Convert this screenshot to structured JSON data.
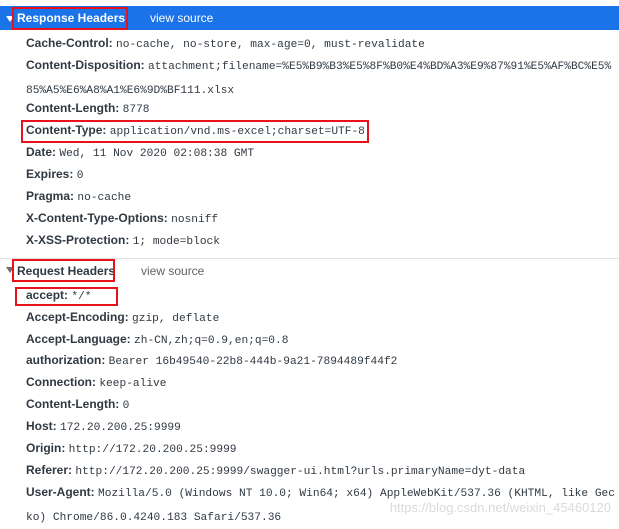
{
  "response_headers": {
    "title": "Response Headers",
    "view_source": "view source",
    "items": [
      {
        "key": "Cache-Control:",
        "value": "no-cache, no-store, max-age=0, must-revalidate"
      },
      {
        "key": "Content-Disposition:",
        "value": "attachment;filename=%E5%B9%B3%E5%8F%B0%E4%BD%A3%E9%87%91%E5%AF%BC%E5%85%A5%E6%A8%A1%E6%9D%BF111.xlsx"
      },
      {
        "key": "Content-Length:",
        "value": "8778"
      },
      {
        "key": "Content-Type:",
        "value": "application/vnd.ms-excel;charset=UTF-8"
      },
      {
        "key": "Date:",
        "value": "Wed, 11 Nov 2020 02:08:38 GMT"
      },
      {
        "key": "Expires:",
        "value": "0"
      },
      {
        "key": "Pragma:",
        "value": "no-cache"
      },
      {
        "key": "X-Content-Type-Options:",
        "value": "nosniff"
      },
      {
        "key": "X-XSS-Protection:",
        "value": "1; mode=block"
      }
    ]
  },
  "request_headers": {
    "title": "Request Headers",
    "view_source": "view source",
    "items": [
      {
        "key": "accept:",
        "value": "*/*"
      },
      {
        "key": "Accept-Encoding:",
        "value": "gzip, deflate"
      },
      {
        "key": "Accept-Language:",
        "value": "zh-CN,zh;q=0.9,en;q=0.8"
      },
      {
        "key": "authorization:",
        "value": "Bearer 16b49540-22b8-444b-9a21-7894489f44f2"
      },
      {
        "key": "Connection:",
        "value": "keep-alive"
      },
      {
        "key": "Content-Length:",
        "value": "0"
      },
      {
        "key": "Host:",
        "value": "172.20.200.25:9999"
      },
      {
        "key": "Origin:",
        "value": "http://172.20.200.25:9999"
      },
      {
        "key": "Referer:",
        "value": "http://172.20.200.25:9999/swagger-ui.html?urls.primaryName=dyt-data"
      },
      {
        "key": "User-Agent:",
        "value": "Mozilla/5.0 (Windows NT 10.0; Win64; x64) AppleWebKit/537.36 (KHTML, like Gecko) Chrome/86.0.4240.183 Safari/537.36"
      }
    ]
  },
  "watermark": "https://blog.csdn.net/weixin_45460120",
  "colors": {
    "accent": "#1a73e8",
    "highlight_box": "#e8121a"
  }
}
